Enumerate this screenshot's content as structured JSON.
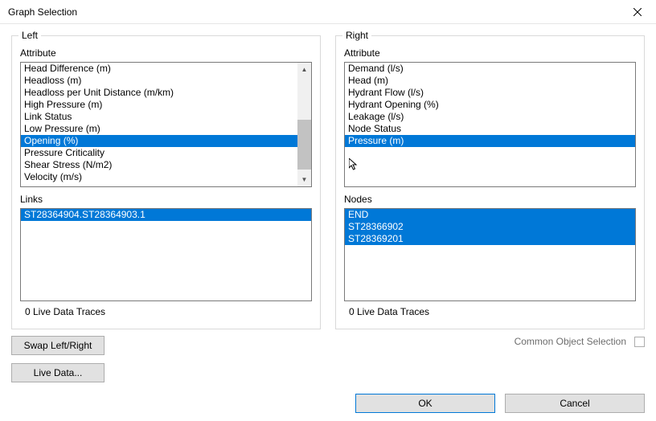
{
  "window": {
    "title": "Graph Selection"
  },
  "left": {
    "label": "Left",
    "attribute_label": "Attribute",
    "attributes": [
      "Head Difference (m)",
      "Headloss (m)",
      "Headloss per Unit Distance (m/km)",
      "High Pressure (m)",
      "Link Status",
      "Low Pressure (m)",
      "Opening (%)",
      "Pressure Criticality",
      "Shear Stress (N/m2)",
      "Velocity (m/s)"
    ],
    "selected_attribute_index": 6,
    "links_label": "Links",
    "links": [
      "ST28364904.ST28364903.1"
    ],
    "links_selected_indices": [
      0
    ],
    "status": "0 Live Data Traces"
  },
  "right": {
    "label": "Right",
    "attribute_label": "Attribute",
    "attributes": [
      "Demand (l/s)",
      "Head (m)",
      "Hydrant Flow (l/s)",
      "Hydrant Opening (%)",
      "Leakage (l/s)",
      "Node Status",
      "Pressure (m)"
    ],
    "selected_attribute_index": 6,
    "nodes_label": "Nodes",
    "nodes": [
      "END",
      "ST28366902",
      "ST28369201"
    ],
    "nodes_selected_indices": [
      0,
      1,
      2
    ],
    "status": "0 Live Data Traces"
  },
  "buttons": {
    "swap": "Swap Left/Right",
    "live_data": "Live Data...",
    "ok": "OK",
    "cancel": "Cancel"
  },
  "common_object_selection": {
    "label": "Common Object Selection",
    "checked": false
  }
}
